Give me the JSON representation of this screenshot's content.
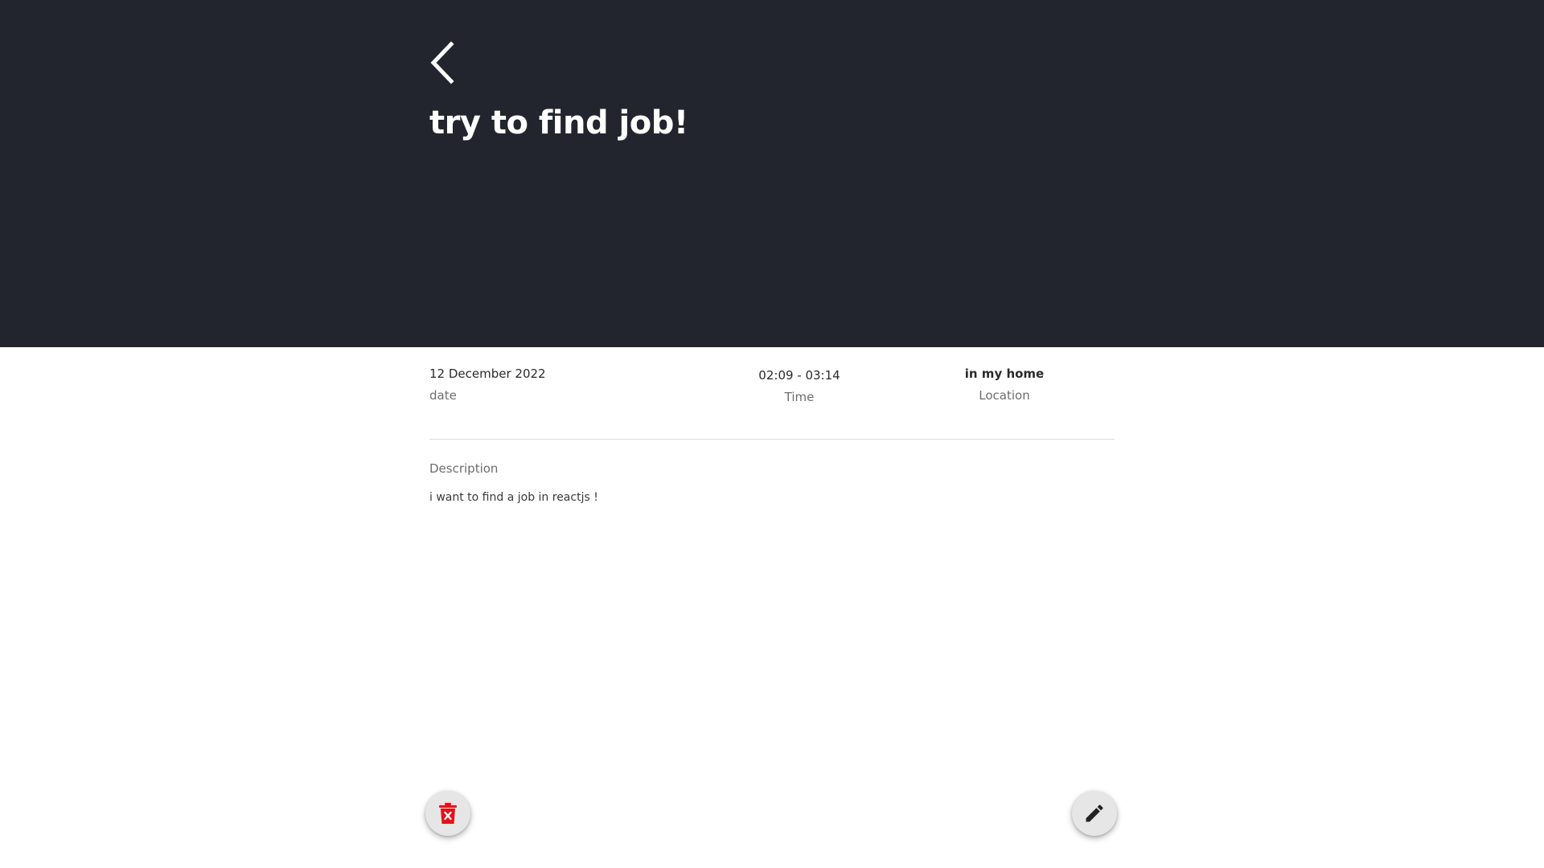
{
  "header": {
    "back_icon": "chevron-left-icon",
    "title": "try to find job!",
    "background": "#22252e"
  },
  "details": {
    "date": {
      "value": "12 December 2022",
      "label": "date"
    },
    "time": {
      "value": "02:09 - 03:14",
      "label": "Time"
    },
    "location": {
      "value": "in my home",
      "label": "Location"
    }
  },
  "description": {
    "label": "Description",
    "text": "i want to find a job in reactjs !"
  },
  "actions": {
    "delete_icon": "trash-icon",
    "delete_color": "#e8101a",
    "edit_icon": "pencil-icon",
    "edit_color": "#222222"
  }
}
